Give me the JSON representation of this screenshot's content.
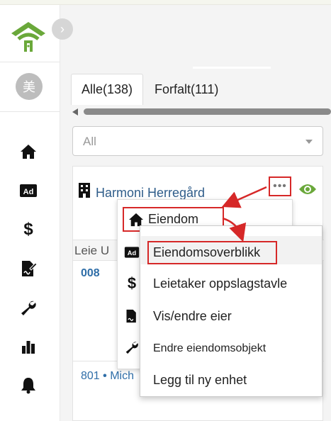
{
  "sidebar": {
    "avatar_initial": "美",
    "nav": [
      {
        "icon": "home-icon"
      },
      {
        "icon": "ad-icon",
        "label": "Ad"
      },
      {
        "icon": "dollar-icon",
        "label": "$"
      },
      {
        "icon": "contract-icon"
      },
      {
        "icon": "wrench-icon"
      },
      {
        "icon": "bar-chart-icon"
      },
      {
        "icon": "bell-icon"
      }
    ]
  },
  "tabs": [
    {
      "label": "Alle(138)",
      "active": true
    },
    {
      "label": "Forfalt(111)",
      "active": false
    }
  ],
  "filter": {
    "value": "All"
  },
  "card": {
    "property_name": "Harmoni Herregård",
    "more_label": "•••",
    "column_label": "Leie U",
    "row1": {
      "unit": "008"
    },
    "row2": {
      "unit": "801",
      "separator": " • ",
      "tenant": "Mich"
    }
  },
  "menu1": {
    "eiendom_label": "Eiendom",
    "icons": [
      "ad-icon",
      "dollar-icon",
      "contract-icon",
      "wrench-icon"
    ],
    "dollar_label": "$"
  },
  "submenu": {
    "items": [
      "Eiendomsoverblikk",
      "Leietaker oppslagstavle",
      "Vis/endre eier",
      "Endre eiendomsobjekt",
      "Legg til ny enhet"
    ]
  },
  "colors": {
    "accent_green": "#6aa83a",
    "annotation_red": "#d62828",
    "link_blue": "#2f5d8a"
  }
}
